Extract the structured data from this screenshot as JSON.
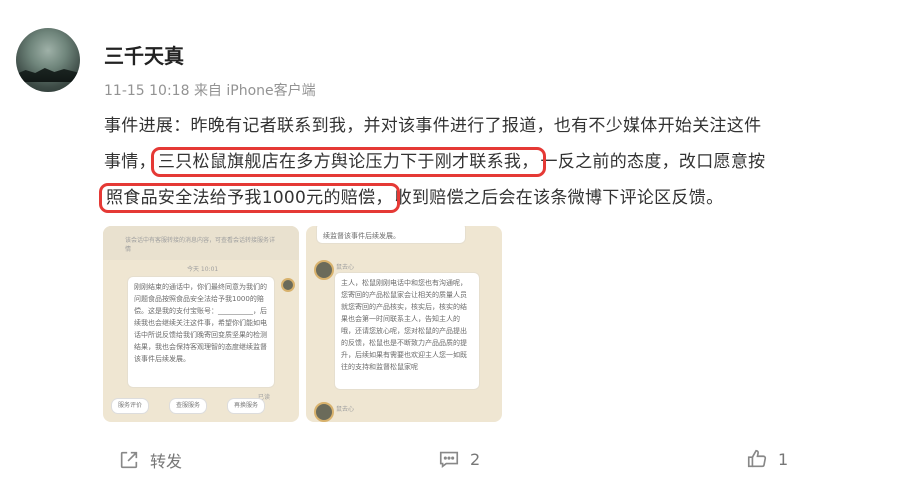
{
  "post": {
    "author": "三千天真",
    "time": "11-15 10:18",
    "source": "来自 iPhone客户端",
    "lines": {
      "l1": "事件进展：昨晚有记者联系到我，并对该事件进行了报道，也有不少媒体开始关注这件",
      "l2_a": "事情，",
      "l2_hl": "三只松鼠旗舰店在多方舆论压力下于刚才联系我，",
      "l2_b": "一反之前的态度，改口愿意按",
      "l3_hl": "照食品安全法给予我1000元的赔偿，",
      "l3_b": "收到赔偿之后会在该条微博下评论区反馈。"
    }
  },
  "images": {
    "left": {
      "top_note": "该会话中有客服转接的消息内容，可查看会话转接服务详情",
      "timestamp": "今天 10:01",
      "bubble": "刚刚结束的通话中，你们最终同意为我们的问题食品按照食品安全法给予我1000的赔偿。这是我的支付宝账号：__________，后续我也会继续关注这件事，希望你们能如电话中所说反馈给我们晚寄回变质坚果的检测结果，我也会保持客观理智的态度继续监督该事件后续发展。",
      "read": "已读",
      "chips": [
        "服务评价",
        "查服服务",
        "再换服务"
      ]
    },
    "right": {
      "top_bubble": "续监督该事件后续发展。",
      "agent_name": "鼠去心",
      "bubble": "主人，松鼠刚刚电话中和您也有沟通呢，您寄回的产品松鼠家会让相关的质量人员就您寄回的产品核实，核实后，核实的结果也会第一时间联系主人，告知主人的哦，还请您放心呢，您对松鼠的产品提出的反馈，松鼠也是不断致力产品品质的提升，后续如果有需要也欢迎主人您一如既往的支持和监督松鼠家呢",
      "agent_name_2": "鼠去心"
    }
  },
  "actions": {
    "repost_label": "转发",
    "comment_count": "2",
    "like_count": "1"
  }
}
